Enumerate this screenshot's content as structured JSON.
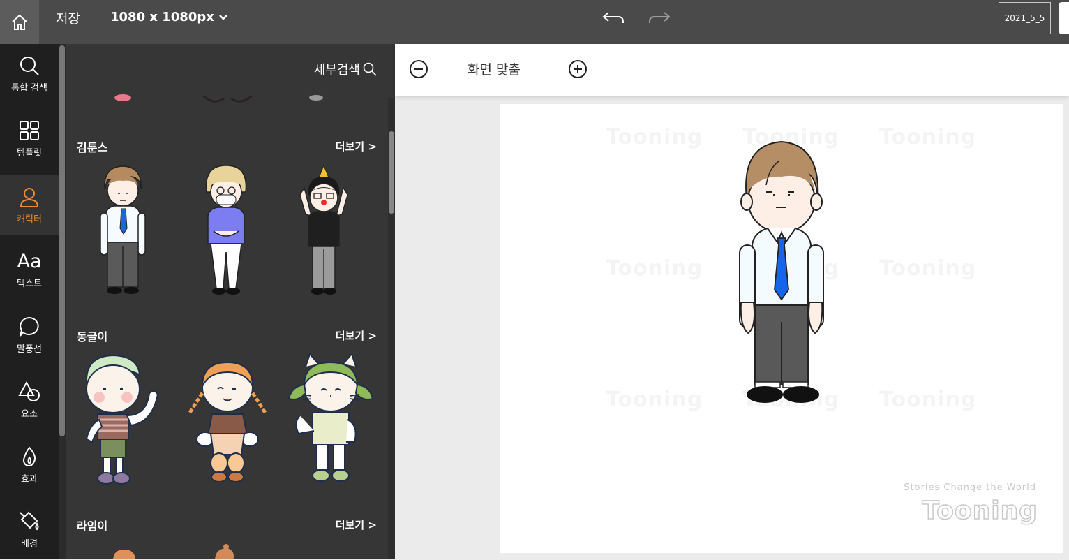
{
  "topbar": {
    "save_label": "저장",
    "canvas_size": "1080 x 1080px",
    "filename": "2021_5_5"
  },
  "nav": {
    "items": [
      {
        "label": "통합 검색",
        "icon": "search-icon"
      },
      {
        "label": "템플릿",
        "icon": "grid-icon"
      },
      {
        "label": "캐릭터",
        "icon": "person-icon"
      },
      {
        "label": "텍스트",
        "icon": "text-icon"
      },
      {
        "label": "말풍선",
        "icon": "speech-bubble-icon"
      },
      {
        "label": "요소",
        "icon": "shapes-icon"
      },
      {
        "label": "효과",
        "icon": "flame-icon"
      },
      {
        "label": "배경",
        "icon": "paint-bucket-icon"
      }
    ],
    "active": "캐릭터",
    "active_color": "#f08c32"
  },
  "panel": {
    "detail_search_label": "세부검색",
    "sections": [
      {
        "title": "김툰스",
        "more": "더보기 >"
      },
      {
        "title": "동글이",
        "more": "더보기 >"
      },
      {
        "title": "라임이",
        "more": "더보기 >"
      }
    ]
  },
  "zoom": {
    "fit_label": "화면 맞춤"
  },
  "canvas": {
    "watermark": "Tooning",
    "tagline": "Stories Change the World",
    "brand": "Tooning"
  }
}
